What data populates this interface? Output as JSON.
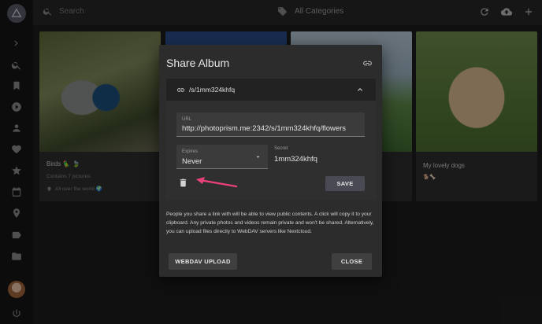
{
  "topbar": {
    "search_placeholder": "Search",
    "categories_label": "All Categories",
    "actions": [
      "refresh-icon",
      "cloud-upload-icon",
      "add-icon"
    ]
  },
  "sidebar": {
    "items": [
      "chevron-right-icon",
      "search-icon",
      "bookmark-icon",
      "play-icon",
      "person-icon",
      "heart-icon",
      "star-icon",
      "calendar-icon",
      "place-icon",
      "label-icon",
      "folder-icon",
      "avatar",
      "power-icon"
    ]
  },
  "albums": [
    {
      "title": "Birds 🦜 🍃",
      "subtitle": "Contains 7 pictures.",
      "location": "All over the world 🌍"
    },
    {
      "title": "",
      "subtitle": ""
    },
    {
      "title": "",
      "subtitle": ""
    },
    {
      "title": "My lovely dogs",
      "subtitle": "🐕🦴"
    }
  ],
  "dialog": {
    "title": "Share Album",
    "link_path": "/s/1mm324khfq",
    "url_label": "URL",
    "url_value": "http://photoprism.me:2342/s/1mm324khfq/flowers",
    "expires_label": "Expires",
    "expires_value": "Never",
    "secret_label": "Secret",
    "secret_value": "1mm324khfq",
    "save_label": "SAVE",
    "info_text": "People you share a link with will be able to view public contents. A click will copy it to your clipboard. Any private photos and videos remain private and won't be shared. Alternatively, you can upload files directly to WebDAV servers like Nextcloud.",
    "webdav_label": "WEBDAV UPLOAD",
    "close_label": "CLOSE"
  },
  "colors": {
    "accent_arrow": "#e8417a",
    "background": "#1d1d1d",
    "dialog": "#2c2c2c"
  }
}
